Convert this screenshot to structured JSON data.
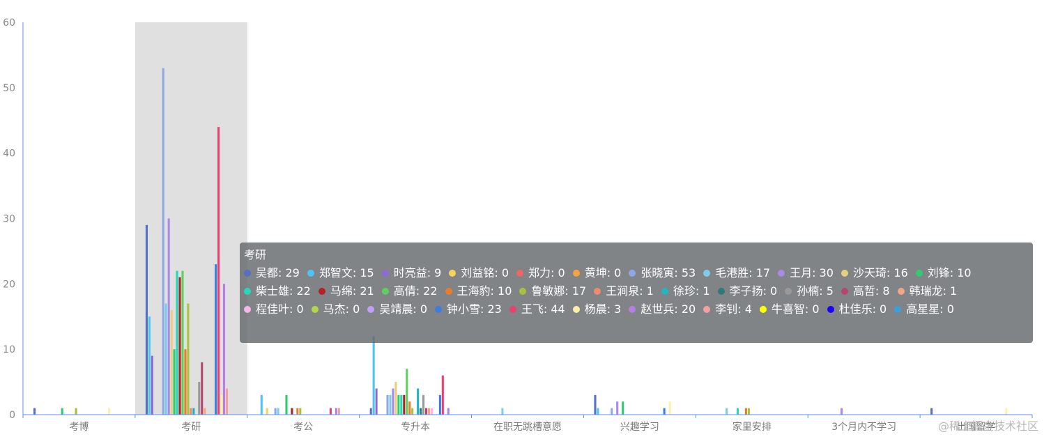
{
  "chart_data": {
    "type": "bar",
    "categories": [
      "考博",
      "考研",
      "考公",
      "专升本",
      "在职无跳槽意愿",
      "兴趣学习",
      "家里安排",
      "3个月内不学习",
      "出国留学"
    ],
    "ylim": [
      0,
      60
    ],
    "yticks": [
      0,
      10,
      20,
      30,
      40,
      50,
      60
    ],
    "grid": false,
    "highlighted_category": "考研",
    "series": [
      {
        "name": "吴都",
        "color": "#5470c6",
        "values": [
          1,
          29,
          0,
          1,
          0,
          3,
          0,
          0,
          1
        ]
      },
      {
        "name": "郑智文",
        "color": "#4fc3f7",
        "values": [
          0,
          15,
          3,
          12,
          0,
          1,
          0,
          0,
          0
        ]
      },
      {
        "name": "时亮益",
        "color": "#8e6ad8",
        "values": [
          0,
          9,
          0,
          4,
          0,
          0,
          0,
          0,
          0
        ]
      },
      {
        "name": "刘益铭",
        "color": "#f6d35b",
        "values": [
          0,
          0,
          1,
          0,
          0,
          0,
          0,
          0,
          0
        ]
      },
      {
        "name": "郑力",
        "color": "#ee6666",
        "values": [
          0,
          0,
          0,
          0,
          0,
          0,
          0,
          0,
          0
        ]
      },
      {
        "name": "黄坤",
        "color": "#f4a340",
        "values": [
          0,
          0,
          0,
          0,
          0,
          0,
          0,
          0,
          0
        ]
      },
      {
        "name": "张晓寅",
        "color": "#8ea7e6",
        "values": [
          0,
          53,
          1,
          3,
          0,
          1,
          0,
          0,
          0
        ]
      },
      {
        "name": "毛港胜",
        "color": "#7ecbea",
        "values": [
          0,
          17,
          1,
          3,
          1,
          0,
          1,
          0,
          0
        ]
      },
      {
        "name": "王月",
        "color": "#a98ae6",
        "values": [
          0,
          30,
          0,
          4,
          0,
          2,
          0,
          1,
          0
        ]
      },
      {
        "name": "沙天琦",
        "color": "#e8cf7e",
        "values": [
          0,
          16,
          0,
          5,
          0,
          0,
          0,
          0,
          0
        ]
      },
      {
        "name": "刘锋",
        "color": "#2ecc71",
        "values": [
          1,
          10,
          3,
          3,
          0,
          2,
          0,
          0,
          0
        ]
      },
      {
        "name": "柴士雄",
        "color": "#28d6b8",
        "values": [
          0,
          22,
          0,
          3,
          0,
          0,
          1,
          0,
          0
        ]
      },
      {
        "name": "马绵",
        "color": "#b22222",
        "values": [
          0,
          21,
          1,
          3,
          0,
          0,
          0,
          0,
          0
        ]
      },
      {
        "name": "高倩",
        "color": "#5dd05d",
        "values": [
          0,
          22,
          0,
          7,
          0,
          0,
          0,
          0,
          0
        ]
      },
      {
        "name": "王海豹",
        "color": "#e87e2c",
        "values": [
          0,
          10,
          1,
          2,
          0,
          0,
          1,
          0,
          0
        ]
      },
      {
        "name": "鲁敏娜",
        "color": "#a8c23a",
        "values": [
          1,
          17,
          1,
          1,
          0,
          0,
          1,
          0,
          0
        ]
      },
      {
        "name": "王涧泉",
        "color": "#f08a6c",
        "values": [
          0,
          1,
          0,
          0,
          0,
          0,
          0,
          0,
          0
        ]
      },
      {
        "name": "徐珍",
        "color": "#1fb5c2",
        "values": [
          0,
          1,
          0,
          4,
          0,
          0,
          0,
          0,
          0
        ]
      },
      {
        "name": "李子扬",
        "color": "#2e7a7a",
        "values": [
          0,
          0,
          0,
          1,
          0,
          0,
          0,
          0,
          0
        ]
      },
      {
        "name": "孙楠",
        "color": "#999999",
        "values": [
          0,
          5,
          0,
          3,
          0,
          0,
          0,
          0,
          0
        ]
      },
      {
        "name": "高哲",
        "color": "#b5456e",
        "values": [
          0,
          8,
          0,
          1,
          0,
          0,
          0,
          0,
          0
        ]
      },
      {
        "name": "韩瑞龙",
        "color": "#f4a582",
        "values": [
          0,
          1,
          0,
          1,
          0,
          0,
          0,
          0,
          0
        ]
      },
      {
        "name": "程佳叶",
        "color": "#f7b6ea",
        "values": [
          0,
          0,
          0,
          1,
          0,
          0,
          0,
          0,
          0
        ]
      },
      {
        "name": "马杰",
        "color": "#b5d646",
        "values": [
          0,
          0,
          0,
          0,
          0,
          0,
          0,
          0,
          0
        ]
      },
      {
        "name": "吴靖晨",
        "color": "#c39ef2",
        "values": [
          0,
          0,
          0,
          0,
          0,
          0,
          0,
          0,
          0
        ]
      },
      {
        "name": "钟小雪",
        "color": "#3d7de0",
        "values": [
          0,
          23,
          0,
          3,
          0,
          1,
          0,
          0,
          0
        ]
      },
      {
        "name": "王飞",
        "color": "#ec4070",
        "values": [
          0,
          44,
          1,
          6,
          0,
          0,
          0,
          0,
          0
        ]
      },
      {
        "name": "杨晨",
        "color": "#fdf0a8",
        "values": [
          1,
          3,
          0,
          0,
          0,
          2,
          0,
          0,
          1
        ]
      },
      {
        "name": "赵世兵",
        "color": "#b77ee8",
        "values": [
          0,
          20,
          1,
          1,
          0,
          0,
          0,
          0,
          0
        ]
      },
      {
        "name": "李钊",
        "color": "#f4a0a0",
        "values": [
          0,
          4,
          1,
          0,
          0,
          0,
          0,
          0,
          0
        ]
      },
      {
        "name": "牛喜智",
        "color": "#ffff00",
        "values": [
          0,
          0,
          0,
          0,
          0,
          0,
          0,
          0,
          0
        ]
      },
      {
        "name": "杜佳乐",
        "color": "#1a00ff",
        "values": [
          0,
          0,
          0,
          0,
          0,
          0,
          0,
          0,
          0
        ]
      },
      {
        "name": "高星星",
        "color": "#3aa0dc",
        "values": [
          0,
          0,
          0,
          0,
          0,
          0,
          0,
          0,
          0
        ]
      }
    ]
  },
  "tooltip": {
    "title": "考研"
  },
  "watermark": "@稀土掘金技术社区"
}
